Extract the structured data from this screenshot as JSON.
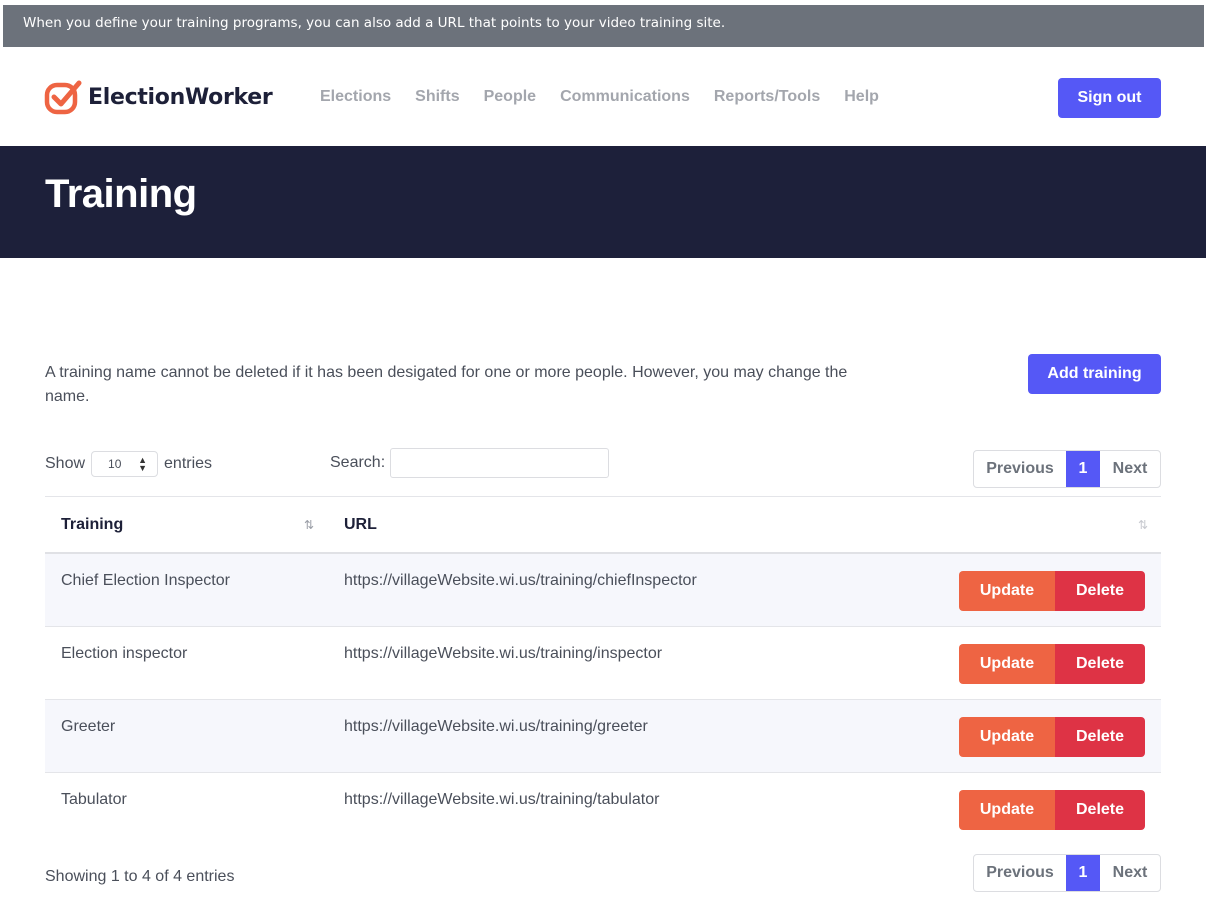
{
  "callout": "When you define your training programs, you can also add a URL that points to your video training site.",
  "brand": {
    "name": "ElectionWorker",
    "logo_icon": "check-badge-icon",
    "accent": "#ee6443"
  },
  "nav": {
    "items": [
      {
        "label": "Elections"
      },
      {
        "label": "Shifts"
      },
      {
        "label": "People"
      },
      {
        "label": "Communications"
      },
      {
        "label": "Reports/Tools"
      },
      {
        "label": "Help"
      }
    ],
    "sign_out": "Sign out"
  },
  "page": {
    "title": "Training",
    "note": "A training name cannot be deleted if it has been desigated for one or more people. However, you may change the name.",
    "add_button": "Add training"
  },
  "table_controls": {
    "show_label": "Show",
    "page_length": "10",
    "entries_label": "entries",
    "search_label": "Search:",
    "search_value": "",
    "info": "Showing 1 to 4 of 4 entries"
  },
  "pagination": {
    "previous": "Previous",
    "current": "1",
    "next": "Next"
  },
  "table": {
    "columns": [
      "Training",
      "URL"
    ],
    "sort_icon": "⇅",
    "rows": [
      {
        "name": "Chief Election Inspector",
        "url": "https://villageWebsite.wi.us/training/chiefInspector",
        "update": "Update",
        "delete": "Delete"
      },
      {
        "name": "Election inspector",
        "url": "https://villageWebsite.wi.us/training/inspector",
        "update": "Update",
        "delete": "Delete"
      },
      {
        "name": "Greeter",
        "url": "https://villageWebsite.wi.us/training/greeter",
        "update": "Update",
        "delete": "Delete"
      },
      {
        "name": "Tabulator",
        "url": "https://villageWebsite.wi.us/training/tabulator",
        "update": "Update",
        "delete": "Delete"
      }
    ]
  },
  "colors": {
    "primary": "#5558f6",
    "hero_bg": "#1d203a",
    "update": "#ee6443",
    "delete": "#de3345",
    "callout_bg": "#6c727b"
  }
}
